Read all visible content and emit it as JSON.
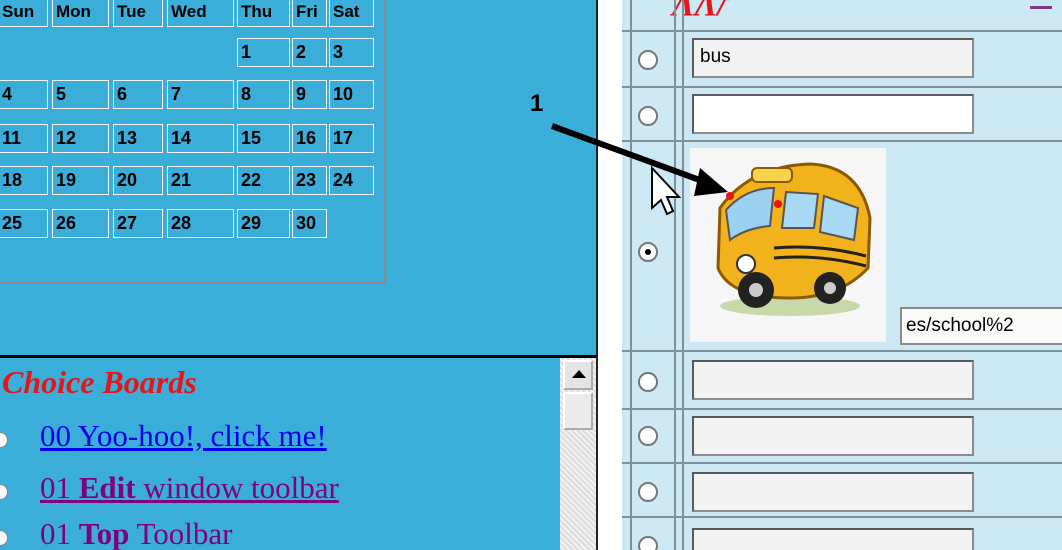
{
  "calendar": {
    "headers": [
      "Sun",
      "Mon",
      "Tue",
      "Wed",
      "Thu",
      "Fri",
      "Sat"
    ],
    "weeks": [
      [
        "",
        "",
        "",
        "",
        "1",
        "2",
        "3"
      ],
      [
        "4",
        "5",
        "6",
        "7",
        "8",
        "9",
        "10"
      ],
      [
        "11",
        "12",
        "13",
        "14",
        "15",
        "16",
        "17"
      ],
      [
        "18",
        "19",
        "20",
        "21",
        "22",
        "23",
        "24"
      ],
      [
        "25",
        "26",
        "27",
        "28",
        "29",
        "30",
        ""
      ]
    ]
  },
  "choice_boards": {
    "title": "Choice Boards",
    "items": [
      {
        "prefix": "00 ",
        "bold": "",
        "suffix": "Yoo-hoo!, click me!"
      },
      {
        "prefix": "01 ",
        "bold": "Edit",
        "suffix": " window toolbar"
      },
      {
        "prefix": "01 ",
        "bold": "Top",
        "suffix": " Toolbar"
      }
    ]
  },
  "table": {
    "rows": [
      {
        "radio": "off",
        "value": "bus",
        "type": "text"
      },
      {
        "radio": "off",
        "value": "",
        "type": "text"
      },
      {
        "radio": "on",
        "value": "es/school%2",
        "type": "image"
      },
      {
        "radio": "off",
        "value": "",
        "type": "text"
      },
      {
        "radio": "off",
        "value": "",
        "type": "text"
      },
      {
        "radio": "off",
        "value": "",
        "type": "text"
      },
      {
        "radio": "off",
        "value": "",
        "type": "text"
      }
    ]
  },
  "annotation": {
    "number": "1"
  },
  "colors": {
    "background": "#3aaed8",
    "right_pane": "#cde8f5",
    "choice_title": "#e8141a",
    "link_blue": "#0000ee",
    "link_visited": "#800080"
  }
}
